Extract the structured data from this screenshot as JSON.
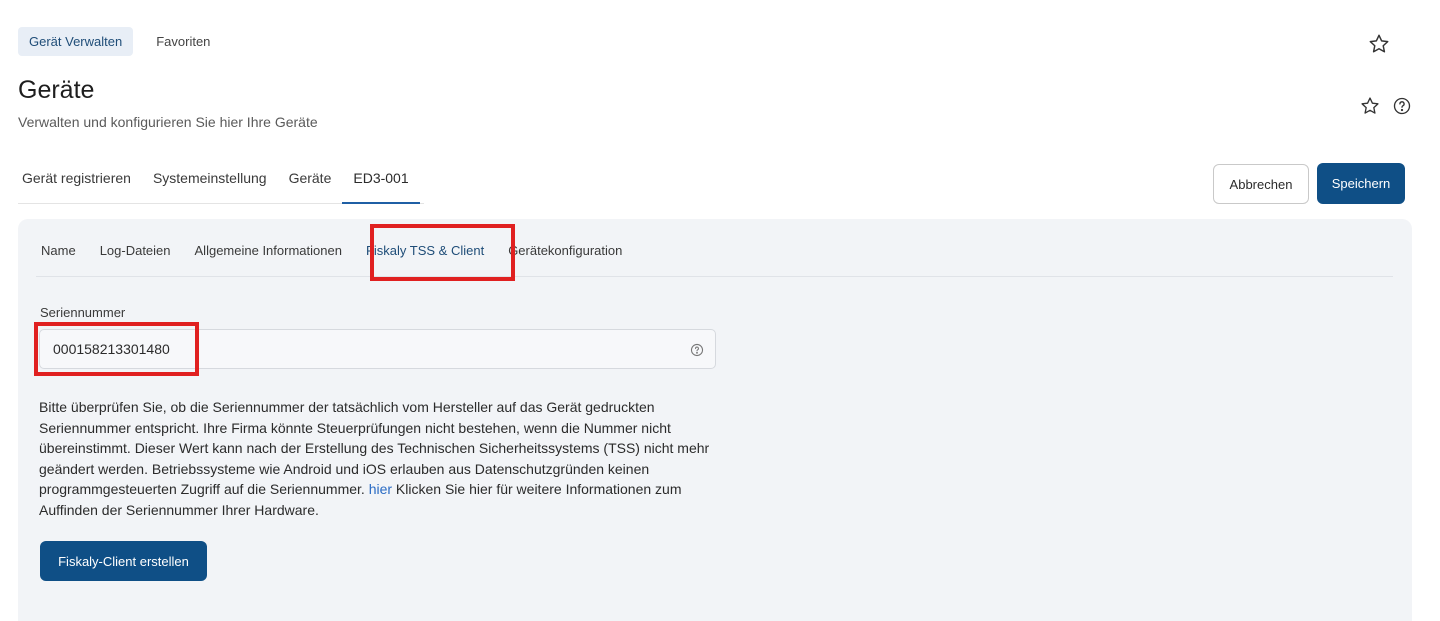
{
  "top_tabs": [
    {
      "label": "Gerät Verwalten",
      "active": true
    },
    {
      "label": "Favoriten",
      "active": false
    }
  ],
  "header": {
    "title": "Geräte",
    "subtitle": "Verwalten und konfigurieren Sie hier Ihre Geräte",
    "icons": [
      "star-icon",
      "help-icon"
    ]
  },
  "sub_tabs": [
    {
      "label": "Gerät registrieren"
    },
    {
      "label": "Systemeinstellung"
    },
    {
      "label": "Geräte"
    },
    {
      "label": "ED3-001",
      "active": true
    }
  ],
  "actions": {
    "cancel_label": "Abbrechen",
    "save_label": "Speichern"
  },
  "inner_tabs": [
    {
      "label": "Name"
    },
    {
      "label": "Log-Dateien"
    },
    {
      "label": "Allgemeine Informationen"
    },
    {
      "label": "Fiskaly TSS & Client",
      "active": true
    },
    {
      "label": "Gerätekonfiguration"
    }
  ],
  "serial": {
    "label": "Seriennummer",
    "value": "000158213301480"
  },
  "info": {
    "text_before_link": "Bitte überprüfen Sie, ob die Seriennummer der tatsächlich vom Hersteller auf das Gerät gedruckten Seriennummer entspricht. Ihre Firma könnte Steuerprüfungen nicht bestehen, wenn die Nummer nicht übereinstimmt. Dieser Wert kann nach der Erstellung des Technischen Sicherheitssystems (TSS) nicht mehr geändert werden. Betriebssysteme wie Android und iOS erlauben aus Datenschutzgründen keinen programmgesteuerten Zugriff auf die Seriennummer. ",
    "link_text": "hier",
    "text_after_link": "  Klicken Sie hier für weitere Informationen zum Auffinden der Seriennummer Ihrer Hardware."
  },
  "client_button_label": "Fiskaly-Client erstellen",
  "colors": {
    "primary": "#0f4f86",
    "highlight": "#e02020",
    "link": "#2a6bc4",
    "panel_bg": "#f2f4f7"
  }
}
